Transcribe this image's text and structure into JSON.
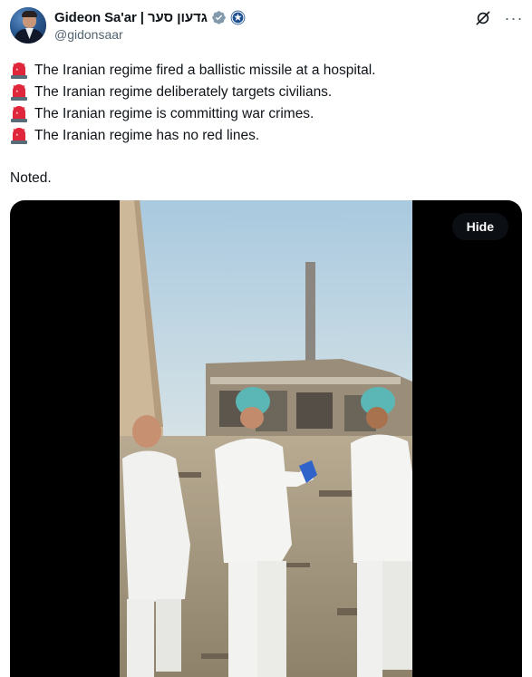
{
  "author": {
    "display_name": "Gideon Sa'ar | גדעון סער",
    "handle": "@gidonsaar",
    "avatar_icon": "profile-photo",
    "verified_color": "#829aab"
  },
  "actions": {
    "grok_icon": "grok-icon",
    "more_label": "···"
  },
  "tweet": {
    "lines": [
      "The Iranian regime fired a ballistic missile at a hospital.",
      "The Iranian regime deliberately targets civilians.",
      "The Iranian regime is committing war crimes.",
      "The Iranian regime has no red lines."
    ],
    "line_icon": "police-siren-emoji",
    "closing": "Noted."
  },
  "media": {
    "hide_label": "Hide"
  }
}
